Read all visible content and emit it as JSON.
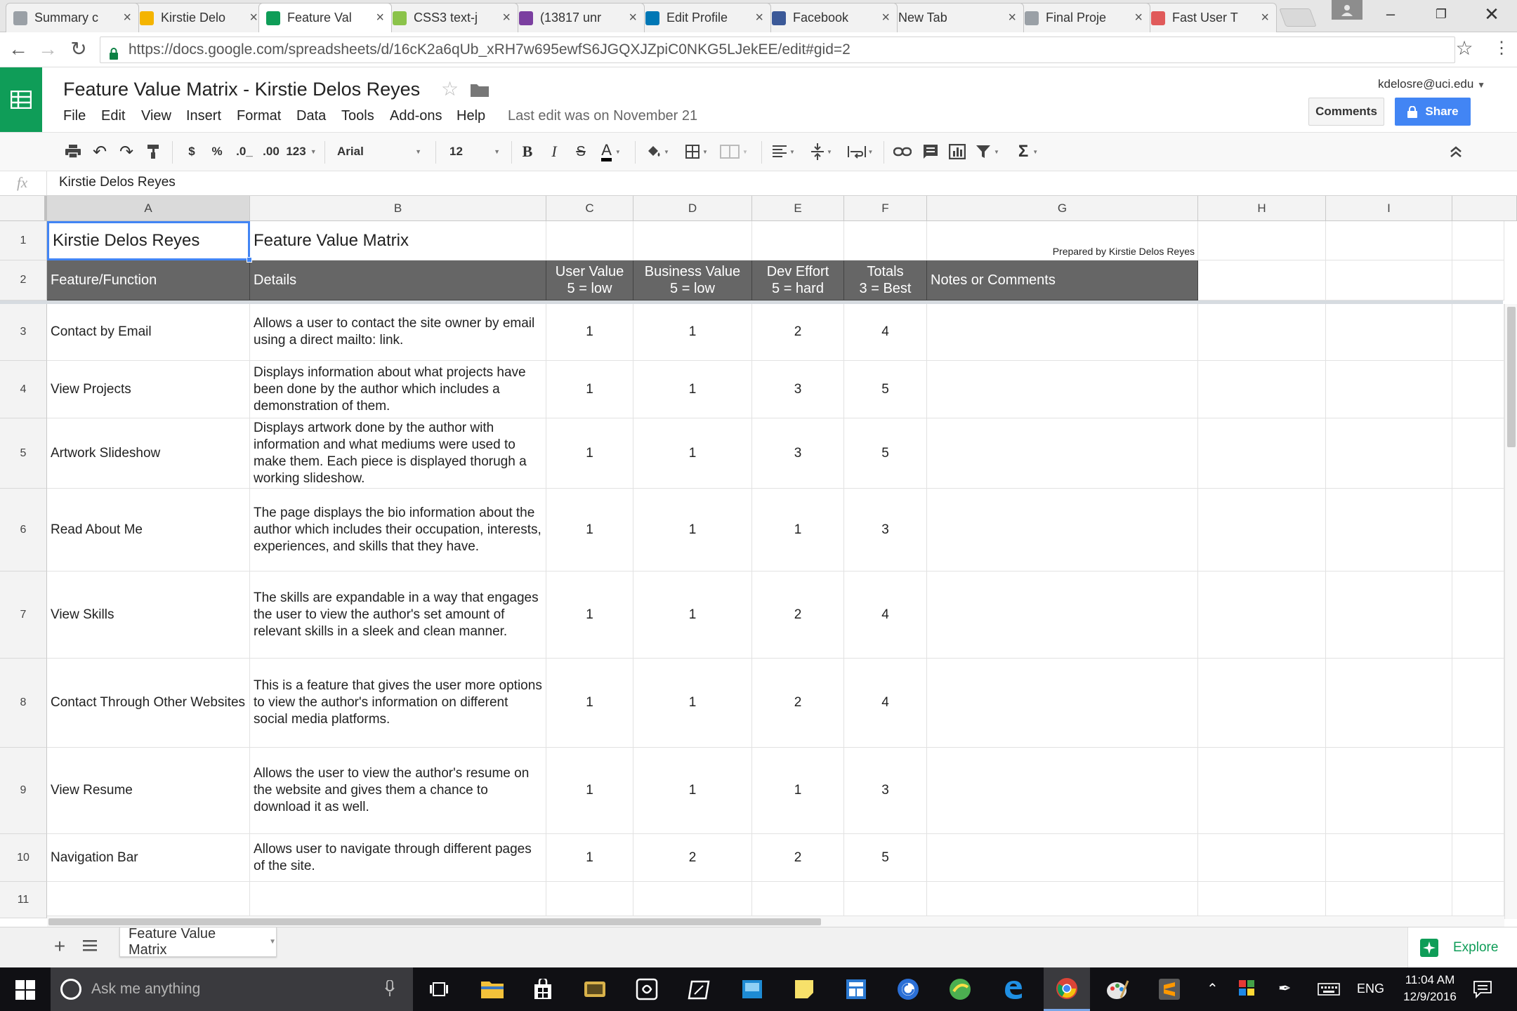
{
  "browser": {
    "tabs": [
      {
        "title": "Summary c",
        "favicon": "document-icon",
        "color": "#9aa0a6"
      },
      {
        "title": "Kirstie Delo",
        "favicon": "drive-icon",
        "color": "#f4b400"
      },
      {
        "title": "Feature Val",
        "favicon": "sheets-icon",
        "color": "#0f9d58"
      },
      {
        "title": "CSS3 text-j",
        "favicon": "css-icon",
        "color": "#8bc34a"
      },
      {
        "title": "(13817 unr",
        "favicon": "mail-icon",
        "color": "#7b3fa0"
      },
      {
        "title": "Edit Profile",
        "favicon": "linkedin-icon",
        "color": "#0077b5"
      },
      {
        "title": "Facebook",
        "favicon": "facebook-icon",
        "color": "#3b5998"
      },
      {
        "title": "New Tab",
        "favicon": "",
        "color": ""
      },
      {
        "title": "Final Proje",
        "favicon": "document-icon",
        "color": "#9aa0a6"
      },
      {
        "title": "Fast User T",
        "favicon": "user-icon",
        "color": "#e05a5a"
      }
    ],
    "url": "https://docs.google.com/spreadsheets/d/16cK2a6qUb_xRH7w695ewfS6JGQXJZpiC0NKG5LJekEE/edit#gid=2"
  },
  "doc": {
    "title": "Feature Value Matrix - Kirstie Delos Reyes",
    "menus": [
      "File",
      "Edit",
      "View",
      "Insert",
      "Format",
      "Data",
      "Tools",
      "Add-ons",
      "Help"
    ],
    "last_edit": "Last edit was on November 21",
    "user": "kdelosre@uci.edu",
    "comments_label": "Comments",
    "share_label": "Share"
  },
  "toolbar": {
    "currency": "$",
    "percent": "%",
    "dec_less": ".0_",
    "dec_more": ".00",
    "number_format": "123",
    "font": "Arial",
    "font_size": "12"
  },
  "formula_bar": {
    "fx": "fx",
    "content": "Kirstie Delos Reyes"
  },
  "grid": {
    "columns": [
      "A",
      "B",
      "C",
      "D",
      "E",
      "F",
      "G",
      "H",
      "I"
    ],
    "row_numbers": [
      "1",
      "2",
      "3",
      "4",
      "5",
      "6",
      "7",
      "8",
      "9",
      "10",
      "11"
    ],
    "title_cell": "Kirstie Delos Reyes",
    "subtitle_cell": "Feature Value Matrix",
    "prepared_by": "Prepared by Kirstie Delos Reyes",
    "headers": {
      "feature": "Feature/Function",
      "details": "Details",
      "user_value": [
        "User Value",
        "5 = low"
      ],
      "business_value": [
        "Business Value",
        "5 = low"
      ],
      "dev_effort": [
        "Dev Effort",
        "5 = hard"
      ],
      "totals": [
        "Totals",
        "3 = Best"
      ],
      "notes": "Notes or Comments"
    },
    "rows": [
      {
        "feature": "Contact by Email",
        "details": "Allows a user to contact the site owner by email using a direct mailto: link.",
        "user": "1",
        "business": "1",
        "dev": "2",
        "total": "4"
      },
      {
        "feature": "View Projects",
        "details": "Displays information about what projects have been done by the author which includes a demonstration of them.",
        "user": "1",
        "business": "1",
        "dev": "3",
        "total": "5"
      },
      {
        "feature": "Artwork Slideshow",
        "details": "Displays artwork done by the author with information and what mediums were used to make them. Each piece is displayed thorugh a working slideshow.",
        "user": "1",
        "business": "1",
        "dev": "3",
        "total": "5"
      },
      {
        "feature": "Read About Me",
        "details": "The page displays the bio information about the author which includes their occupation, interests, experiences, and skills that they have.",
        "user": "1",
        "business": "1",
        "dev": "1",
        "total": "3"
      },
      {
        "feature": "View Skills",
        "details": "The skills are expandable in a way that engages the user to view the author's set amount of relevant skills in a sleek and clean manner.",
        "user": "1",
        "business": "1",
        "dev": "2",
        "total": "4"
      },
      {
        "feature": "Contact Through Other Websites",
        "details": "This is a feature that gives the user more options to view the author's information on different social media platforms.",
        "user": "1",
        "business": "1",
        "dev": "2",
        "total": "4"
      },
      {
        "feature": "View Resume",
        "details": "Allows the user to view the author's resume on the website and gives them a chance to download it as well.",
        "user": "1",
        "business": "1",
        "dev": "1",
        "total": "3"
      },
      {
        "feature": "Navigation Bar",
        "details": "Allows user to navigate through different pages of the site.",
        "user": "1",
        "business": "2",
        "dev": "2",
        "total": "5"
      }
    ]
  },
  "sheet_tabs": {
    "active": "Feature Value Matrix",
    "explore": "Explore"
  },
  "taskbar": {
    "search_placeholder": "Ask me anything",
    "language": "ENG",
    "time": "11:04 AM",
    "date": "12/9/2016"
  }
}
